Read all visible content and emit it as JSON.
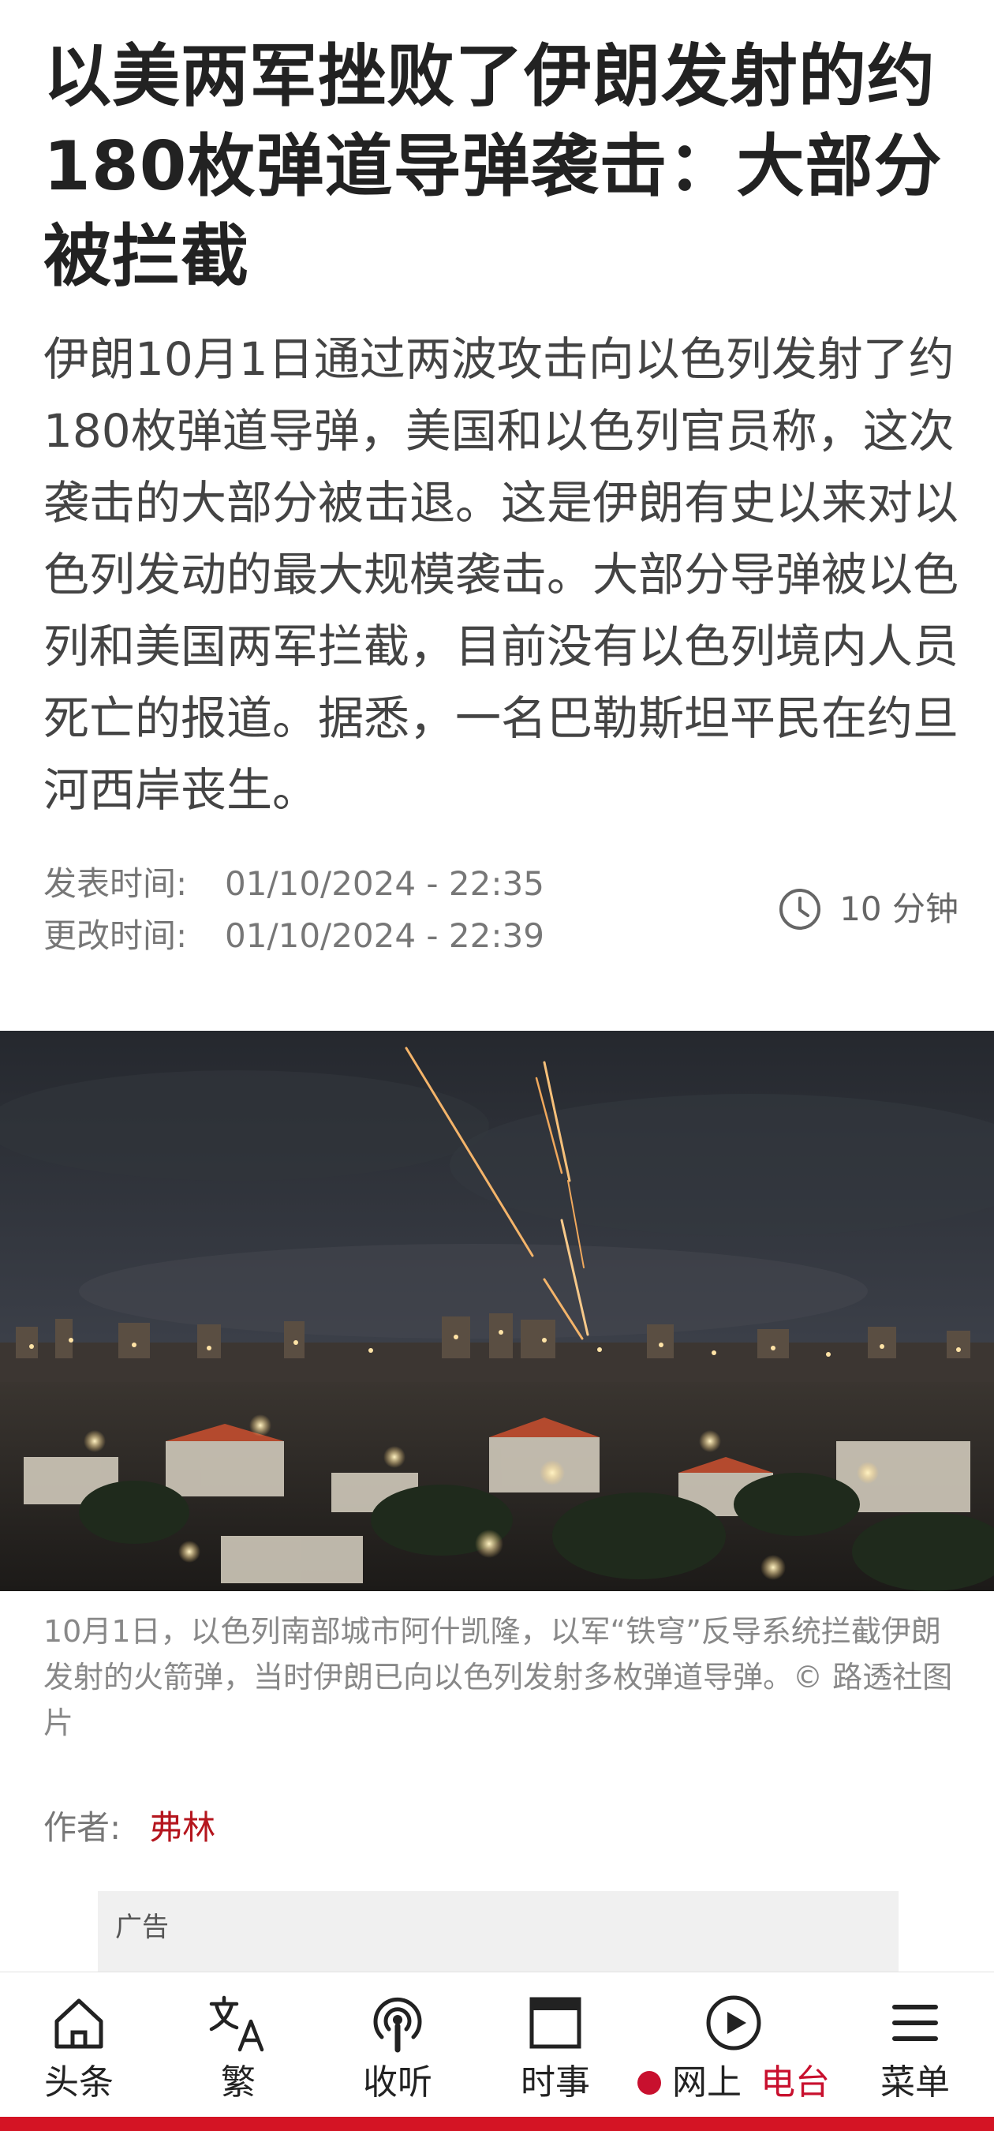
{
  "article": {
    "title": "以美两军挫败了伊朗发射的约180枚弹道导弹袭击：大部分被拦截",
    "summary": "伊朗10月1日通过两波攻击向以色列发射了约180枚弹道导弹，美国和以色列官员称，这次袭击的大部分被击退。这是伊朗有史以来对以色列发动的最大规模袭击。大部分导弹被以色列和美国两军拦截，目前没有以色列境内人员死亡的报道。据悉，一名巴勒斯坦平民在约旦河西岸丧生。",
    "published_label": "发表时间:",
    "published_value": "01/10/2024 - 22:35",
    "updated_label": "更改时间:",
    "updated_value": "01/10/2024 - 22:39",
    "read_time": "10 分钟",
    "read_time_icon": "clock-icon",
    "photo_caption": "10月1日，以色列南部城市阿什凯隆，以军“铁穹”反导系统拦截伊朗发射的火箭弹，当时伊朗已向以色列发射多枚弹道导弹。© 路透社图片",
    "author_label": "作者:",
    "author_name": "弗林"
  },
  "ad": {
    "label": "广告"
  },
  "bottom_nav": {
    "items": [
      {
        "label": "头条",
        "icon": "home-icon"
      },
      {
        "label": "繁",
        "icon": "translate-icon"
      },
      {
        "label": "收听",
        "icon": "podcast-icon"
      },
      {
        "label": "时事",
        "icon": "news-icon"
      },
      {
        "label": "网上",
        "label_accent": "电台",
        "icon": "play-icon"
      },
      {
        "label": "菜单",
        "icon": "menu-icon"
      }
    ]
  },
  "colors": {
    "brand_red": "#d41424",
    "author_red": "#b5161e",
    "live_red": "#c8102e",
    "text": "#222222",
    "muted": "#777777"
  }
}
